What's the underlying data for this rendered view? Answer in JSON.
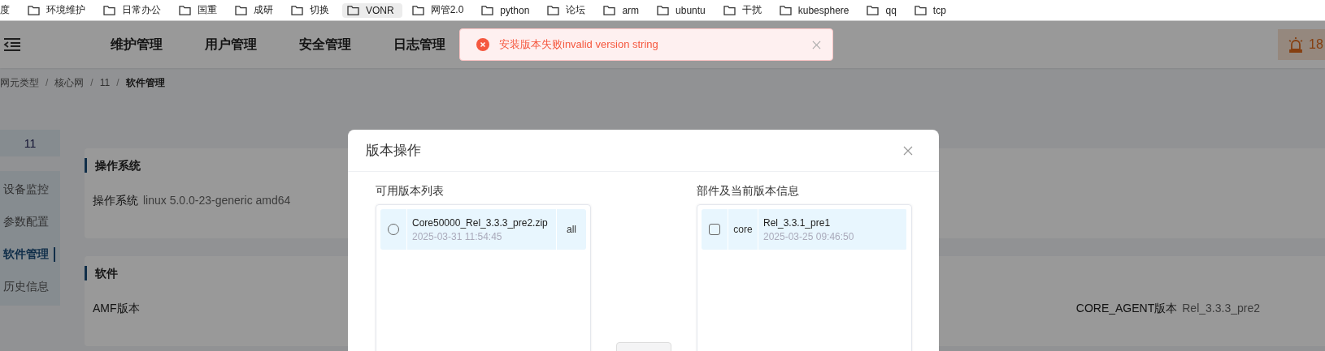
{
  "bookmarks": [
    {
      "label": "度",
      "highlighted": false,
      "icon": false
    },
    {
      "label": "环境维护",
      "highlighted": false,
      "icon": true
    },
    {
      "label": "日常办公",
      "highlighted": false,
      "icon": true
    },
    {
      "label": "国重",
      "highlighted": false,
      "icon": true
    },
    {
      "label": "成研",
      "highlighted": false,
      "icon": true
    },
    {
      "label": "切换",
      "highlighted": false,
      "icon": true
    },
    {
      "label": "VONR",
      "highlighted": true,
      "icon": true
    },
    {
      "label": "网管2.0",
      "highlighted": false,
      "icon": true
    },
    {
      "label": "python",
      "highlighted": false,
      "icon": true
    },
    {
      "label": "论坛",
      "highlighted": false,
      "icon": true
    },
    {
      "label": "arm",
      "highlighted": false,
      "icon": true
    },
    {
      "label": "ubuntu",
      "highlighted": false,
      "icon": true
    },
    {
      "label": "干扰",
      "highlighted": false,
      "icon": true
    },
    {
      "label": "kubesphere",
      "highlighted": false,
      "icon": true
    },
    {
      "label": "qq",
      "highlighted": false,
      "icon": true
    },
    {
      "label": "tcp",
      "highlighted": false,
      "icon": true
    }
  ],
  "header": {
    "nav": [
      "维护管理",
      "用户管理",
      "安全管理",
      "日志管理"
    ],
    "alarm_count": "18"
  },
  "toast": {
    "message": "安装版本失败invalid version string"
  },
  "breadcrumb": {
    "separator": "/",
    "items": [
      "网元类型",
      "核心网",
      "11",
      "软件管理"
    ]
  },
  "sidebar": {
    "title": "11",
    "items": [
      {
        "label": "设备监控",
        "selected": false
      },
      {
        "label": "参数配置",
        "selected": false
      },
      {
        "label": "软件管理",
        "selected": true
      },
      {
        "label": "历史信息",
        "selected": false
      }
    ]
  },
  "sections": [
    {
      "title": "操作系统",
      "fields": [
        {
          "label": "操作系统",
          "value": "linux 5.0.0-23-generic amd64"
        }
      ]
    },
    {
      "title": "软件",
      "fields": [
        {
          "label": "AMF版本"
        },
        {
          "label": "CORE_AGENT版本",
          "value": "Rel_3.3.3_pre2"
        }
      ]
    }
  ],
  "dialog": {
    "title": "版本操作",
    "available": {
      "title": "可用版本列表",
      "items": [
        {
          "name": "Core50000_Rel_3.3.3_pre2.zip",
          "date": "2025-03-31 11:54:45",
          "target": "all",
          "selected": false
        }
      ]
    },
    "components": {
      "title": "部件及当前版本信息",
      "items": [
        {
          "name": "core",
          "version": "Rel_3.3.1_pre1",
          "date": "2025-03-25 09:46:50",
          "checked": false
        }
      ]
    }
  }
}
